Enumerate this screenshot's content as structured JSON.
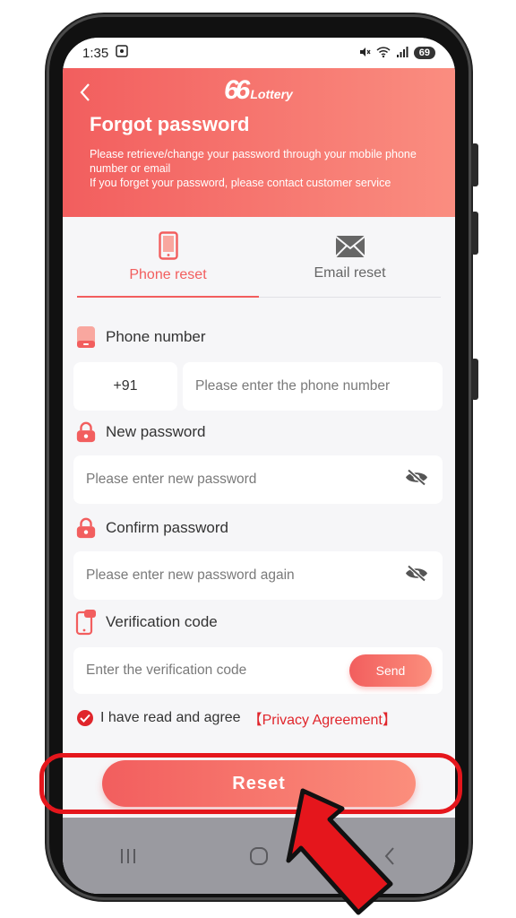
{
  "status_bar": {
    "time": "1:35",
    "battery": "69"
  },
  "header": {
    "logo_number": "66",
    "logo_word": "Lottery",
    "title": "Forgot password",
    "description_line1": "Please retrieve/change your password through your mobile phone number or email",
    "description_line2": "If you forget your password, please contact customer service"
  },
  "tabs": [
    {
      "label": "Phone reset",
      "active": true
    },
    {
      "label": "Email reset",
      "active": false
    }
  ],
  "form": {
    "phone_label": "Phone number",
    "country_code": "+91",
    "phone_placeholder": "Please enter the phone number",
    "new_password_label": "New password",
    "new_password_placeholder": "Please enter new password",
    "confirm_password_label": "Confirm password",
    "confirm_password_placeholder": "Please enter new password again",
    "verification_label": "Verification code",
    "verification_placeholder": "Enter the verification code",
    "send_label": "Send",
    "agree_text": "I have read and agree",
    "privacy_link": "【Privacy Agreement】",
    "agreed": true
  },
  "reset_button": "Reset",
  "colors": {
    "accent": "#f25e5e",
    "accent_light": "#fb8e7c",
    "link": "#e0252b",
    "highlight": "#e5161c"
  }
}
